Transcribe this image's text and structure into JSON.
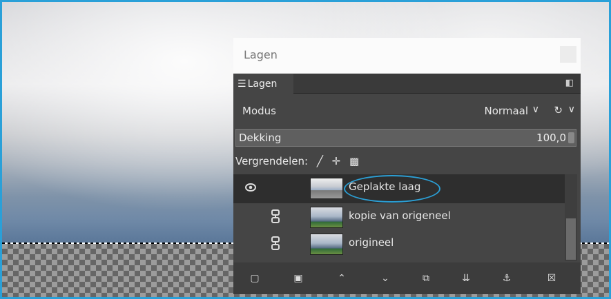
{
  "dialog": {
    "title": "Lagen",
    "tab_label": "Lagen",
    "mode": {
      "label": "Modus",
      "value": "Normaal"
    },
    "opacity": {
      "label": "Dekking",
      "value": "100,0"
    },
    "locks": {
      "label": "Vergrendelen:"
    },
    "layers": [
      {
        "name": "Geplakte laag",
        "visible": true,
        "selected": true
      },
      {
        "name": "kopie van origeneel",
        "linked_icon": "chain-icon"
      },
      {
        "name": "origineel",
        "linked_icon": "chain-icon"
      }
    ],
    "colors": {
      "panel": "#454545",
      "highlight_ellipse": "#2b9fd5",
      "frame": "#2aa0d8"
    }
  }
}
